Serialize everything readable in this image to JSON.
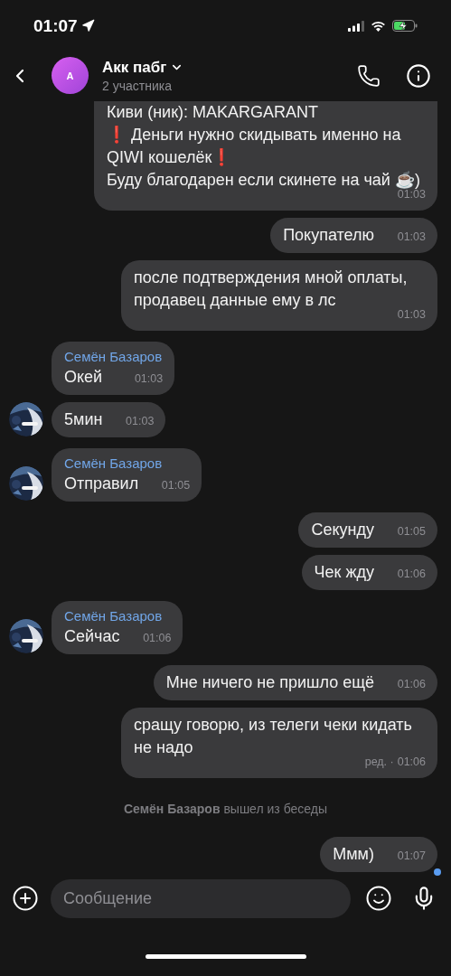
{
  "status_bar": {
    "time": "01:07"
  },
  "header": {
    "avatar_letter": "А",
    "title": "Акк пабг",
    "subtitle": "2 участника"
  },
  "items": [
    {
      "kind": "outgoing",
      "cut_top": true,
      "text": "Киви (ник): MAKARGARANT\n❗ Деньги нужно скидывать именно на QIWI кошелёк❗\nБуду благодарен если скинете на чай ☕)",
      "time": "01:03",
      "unread": false
    },
    {
      "kind": "outgoing",
      "cut_top": false,
      "text": "Покупателю",
      "time": "01:03",
      "unread": false
    },
    {
      "kind": "outgoing",
      "cut_top": false,
      "text": "после подтверждения мной оплаты, продавец данные ему в лс",
      "time": "01:03",
      "unread": false
    },
    {
      "kind": "incoming",
      "cut_top": false,
      "sender": "Семён Базаров",
      "avatar": false,
      "text": "Окей",
      "time": "01:03",
      "unread": false
    },
    {
      "kind": "incoming",
      "cut_top": false,
      "avatar": true,
      "text": "5мин",
      "time": "01:03",
      "unread": false
    },
    {
      "kind": "incoming",
      "cut_top": false,
      "sender": "Семён Базаров",
      "avatar": true,
      "text": "Отправил",
      "time": "01:05",
      "unread": false
    },
    {
      "kind": "outgoing",
      "cut_top": false,
      "text": "Секунду",
      "time": "01:05",
      "unread": false
    },
    {
      "kind": "outgoing",
      "cut_top": false,
      "text": "Чек жду",
      "time": "01:06",
      "unread": false
    },
    {
      "kind": "incoming",
      "cut_top": false,
      "sender": "Семён Базаров",
      "avatar": true,
      "text": "Сейчас",
      "time": "01:06",
      "unread": false
    },
    {
      "kind": "outgoing",
      "cut_top": false,
      "text": "Мне ничего не пришло ещё",
      "time": "01:06",
      "unread": false
    },
    {
      "kind": "outgoing",
      "cut_top": false,
      "text": "сращу говорю, из телеги чеки кидать не надо",
      "edited_label": "ред. ·",
      "time": "01:06",
      "unread": false
    },
    {
      "kind": "system",
      "text": "**Семён Базаров** вышел из беседы"
    },
    {
      "kind": "outgoing",
      "cut_top": false,
      "text": "Ммм)",
      "time": "01:07",
      "unread": true
    }
  ],
  "composer": {
    "placeholder": "Сообщение"
  }
}
